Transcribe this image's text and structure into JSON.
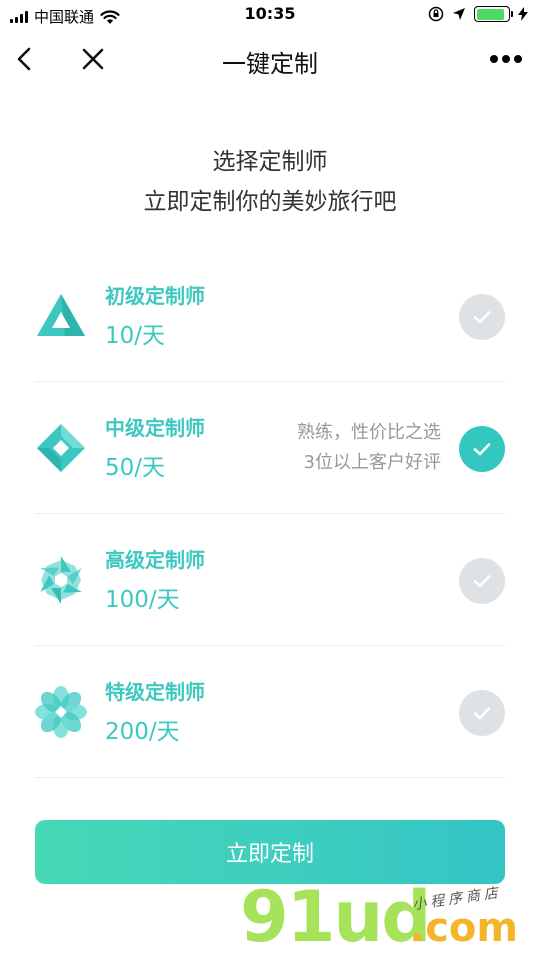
{
  "status_bar": {
    "carrier": "中国联通",
    "time": "10:35",
    "battery_level": 0.9
  },
  "nav": {
    "title": "一键定制",
    "back_icon": "chevron-left-icon",
    "close_icon": "close-icon",
    "more_icon": "more-dots-icon"
  },
  "headline": {
    "line1": "选择定制师",
    "line2": "立即定制你的美妙旅行吧"
  },
  "tiers": [
    {
      "name": "初级定制师",
      "price": "10/天",
      "note1": "",
      "note2": "",
      "selected": false,
      "icon": "triangle-icon"
    },
    {
      "name": "中级定制师",
      "price": "50/天",
      "note1": "熟练，性价比之选",
      "note2": "3位以上客户好评",
      "selected": true,
      "icon": "diamond-icon"
    },
    {
      "name": "高级定制师",
      "price": "100/天",
      "note1": "",
      "note2": "",
      "selected": false,
      "icon": "star-flower-icon"
    },
    {
      "name": "特级定制师",
      "price": "200/天",
      "note1": "",
      "note2": "",
      "selected": false,
      "icon": "lotus-flower-icon"
    }
  ],
  "cta": {
    "label": "立即定制"
  },
  "watermark": {
    "brand": "91ud",
    "domain": ".com",
    "tagline": "小程序商店"
  },
  "colors": {
    "accent": "#3cc8c0",
    "check_on": "#33c7bf",
    "check_off": "#dfe2e5"
  }
}
